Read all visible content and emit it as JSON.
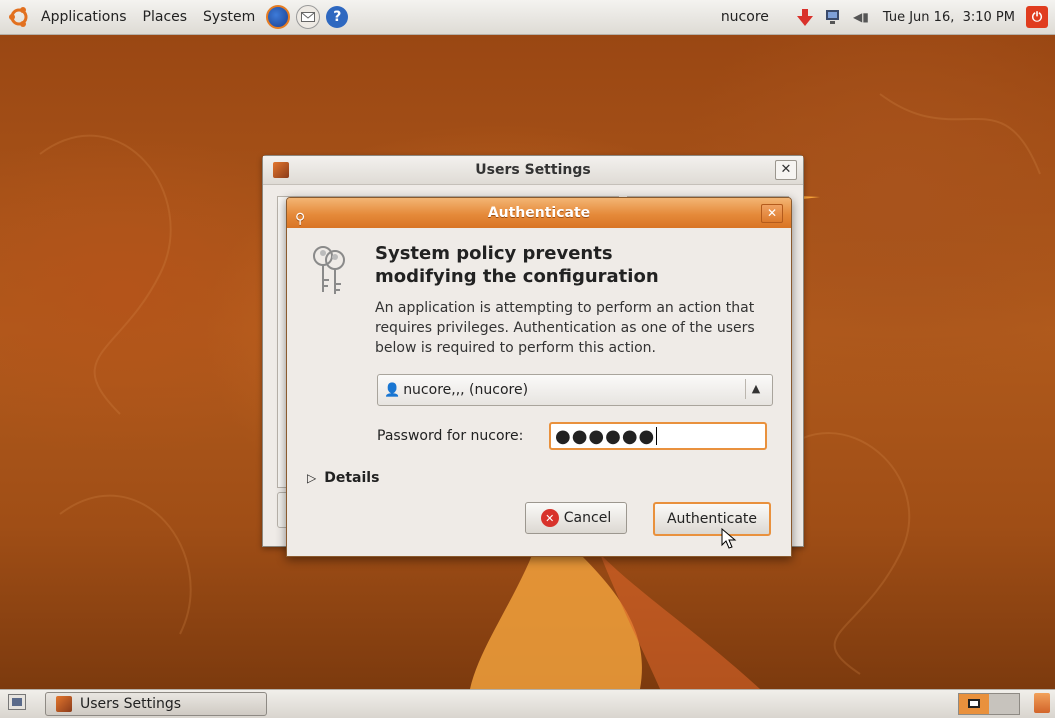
{
  "top_panel": {
    "menus": [
      "Applications",
      "Places",
      "System"
    ],
    "user": "nucore",
    "clock": "Tue Jun 16,  3:10 PM"
  },
  "users_window": {
    "title": "Users Settings"
  },
  "auth_dialog": {
    "title": "Authenticate",
    "heading_line1": "System policy prevents",
    "heading_line2": "modifying the configuration",
    "description": "An application is attempting to perform an action that requires privileges. Authentication as one of the users below is required to perform this action.",
    "user_select_value": "nucore,,, (nucore)",
    "password_label": "Password for nucore:",
    "password_masked": "●●●●●●",
    "details_label": "Details",
    "cancel_label": "Cancel",
    "authenticate_label": "Authenticate"
  },
  "taskbar": {
    "task_label": "Users Settings"
  },
  "colors": {
    "accent": "#e9913d",
    "title_orange": "#e58a3a"
  }
}
